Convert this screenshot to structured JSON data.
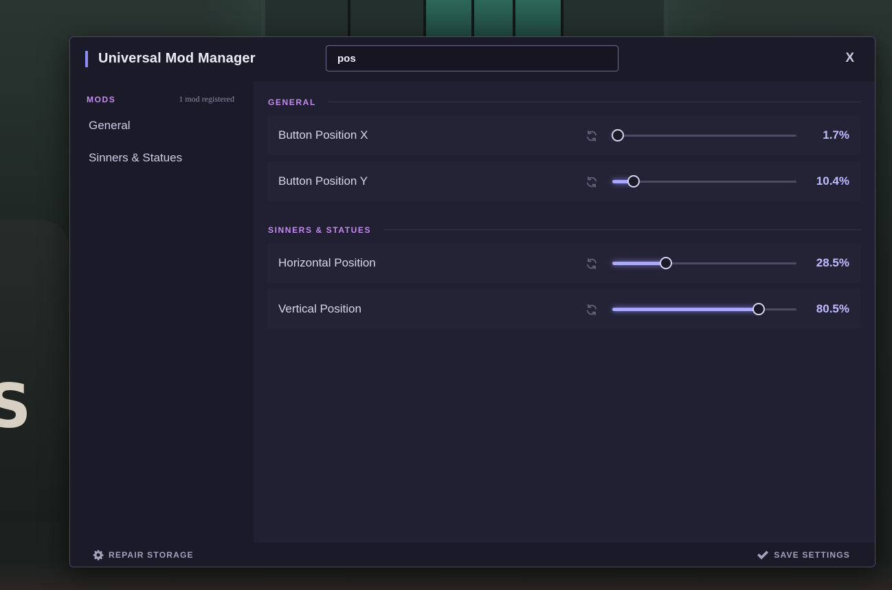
{
  "app": {
    "title": "Universal Mod Manager",
    "close_label": "X"
  },
  "search": {
    "value": "pos"
  },
  "sidebar": {
    "heading": "MODS",
    "count": "1 mod registered",
    "items": [
      {
        "label": "General"
      },
      {
        "label": "Sinners & Statues"
      }
    ]
  },
  "sections": [
    {
      "heading": "GENERAL",
      "settings": [
        {
          "label": "Button Position X",
          "value_text": "1.7%",
          "value": 1.7
        },
        {
          "label": "Button Position Y",
          "value_text": "10.4%",
          "value": 10.4
        }
      ]
    },
    {
      "heading": "SINNERS & STATUES",
      "settings": [
        {
          "label": "Horizontal Position",
          "value_text": "28.5%",
          "value": 28.5
        },
        {
          "label": "Vertical Position",
          "value_text": "80.5%",
          "value": 80.5
        }
      ]
    }
  ],
  "footer": {
    "repair_label": "REPAIR STORAGE",
    "save_label": "SAVE SETTINGS"
  },
  "icons": {
    "reset": "refresh-icon",
    "repair": "gear-icon",
    "save": "checkmark-icon"
  },
  "colors": {
    "accent": "#8f8ef3",
    "section_heading": "#c48bf1",
    "slider_fill": "#a9a9ff",
    "value_text": "#bfbcff"
  }
}
